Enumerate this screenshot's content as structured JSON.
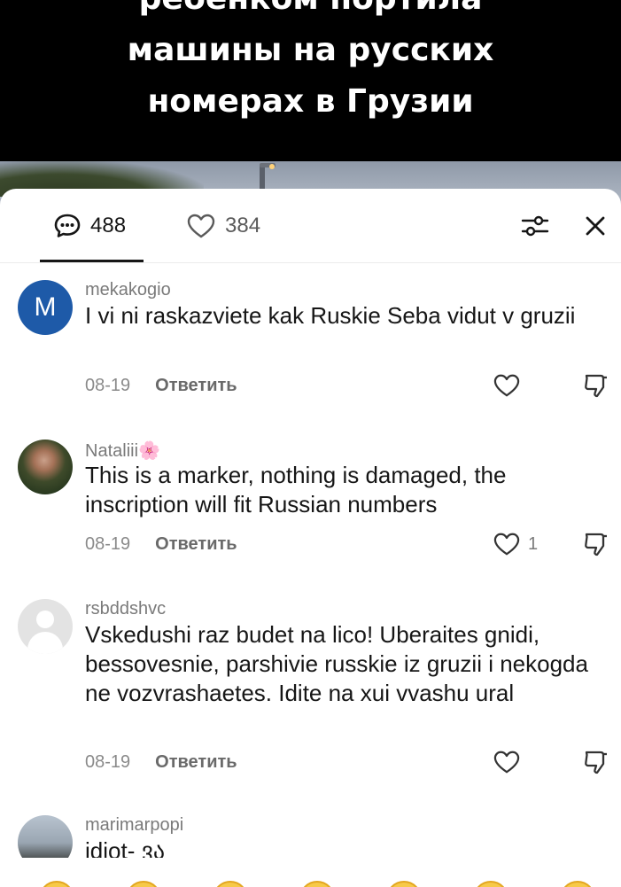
{
  "video": {
    "title_lines": [
      "ребенком портила",
      "машины на русских",
      "номерах в Грузии"
    ]
  },
  "tabs": {
    "comments_count": "488",
    "likes_count": "384"
  },
  "comments": [
    {
      "username": "mekakogio",
      "avatar_letter": "M",
      "text": "I vi ni raskazviete kak Ruskie Seba vidut v gruzii",
      "date": "08-19",
      "reply_label": "Ответить",
      "likes": ""
    },
    {
      "username": "Nataliii🌸",
      "text": "This is a marker, nothing is damaged, the inscription will fit Russian numbers",
      "date": "08-19",
      "reply_label": "Ответить",
      "likes": "1"
    },
    {
      "username": "rsbddshvc",
      "text": "Vskedushi raz budet na lico! Uberaites gnidi, bessovesnie, parshivie russkie iz gruzii i nekogda ne vozvrashaetes. Idite na xui vvashu ural",
      "date": "08-19",
      "reply_label": "Ответить",
      "likes": ""
    },
    {
      "username": "marimarpopi",
      "text": "idiot- ვა"
    }
  ],
  "colors": {
    "accent_text": "#161616",
    "muted_text": "#7a7a7a",
    "avatar_blue": "#1e5aa8",
    "emoji_yellow": "#f7c948"
  },
  "icons": [
    "comment-bubble-icon",
    "heart-icon",
    "filter-sliders-icon",
    "close-icon",
    "dislike-icon",
    "emoji-icon"
  ]
}
